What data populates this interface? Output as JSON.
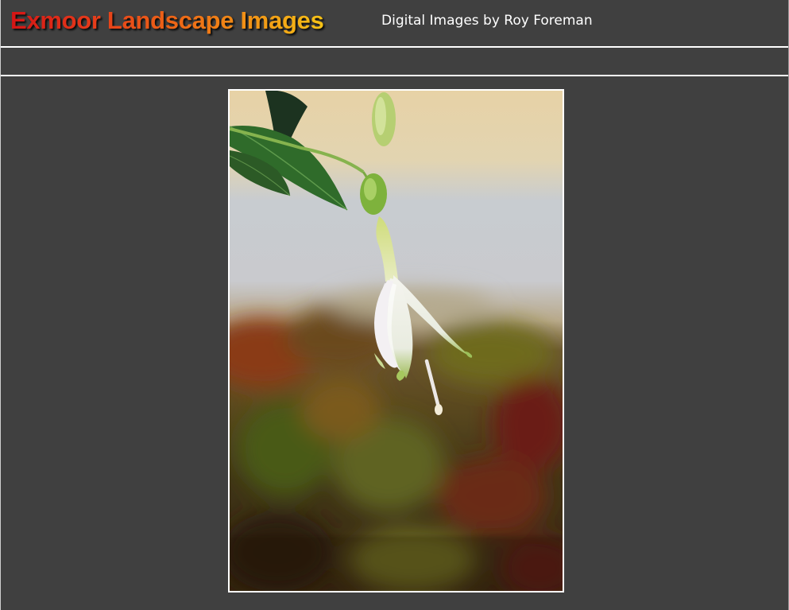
{
  "header": {
    "site_title": "Exmoor Landscape Images",
    "subtitle": "Digital Images by Roy Foreman"
  },
  "photo": {
    "subject": "flower-photo"
  },
  "colors": {
    "page_background": "#404040",
    "divider": "#ffffff",
    "title_gradient_start": "#d41515",
    "title_gradient_end": "#f6c316",
    "subtitle_text": "#ffffff"
  }
}
